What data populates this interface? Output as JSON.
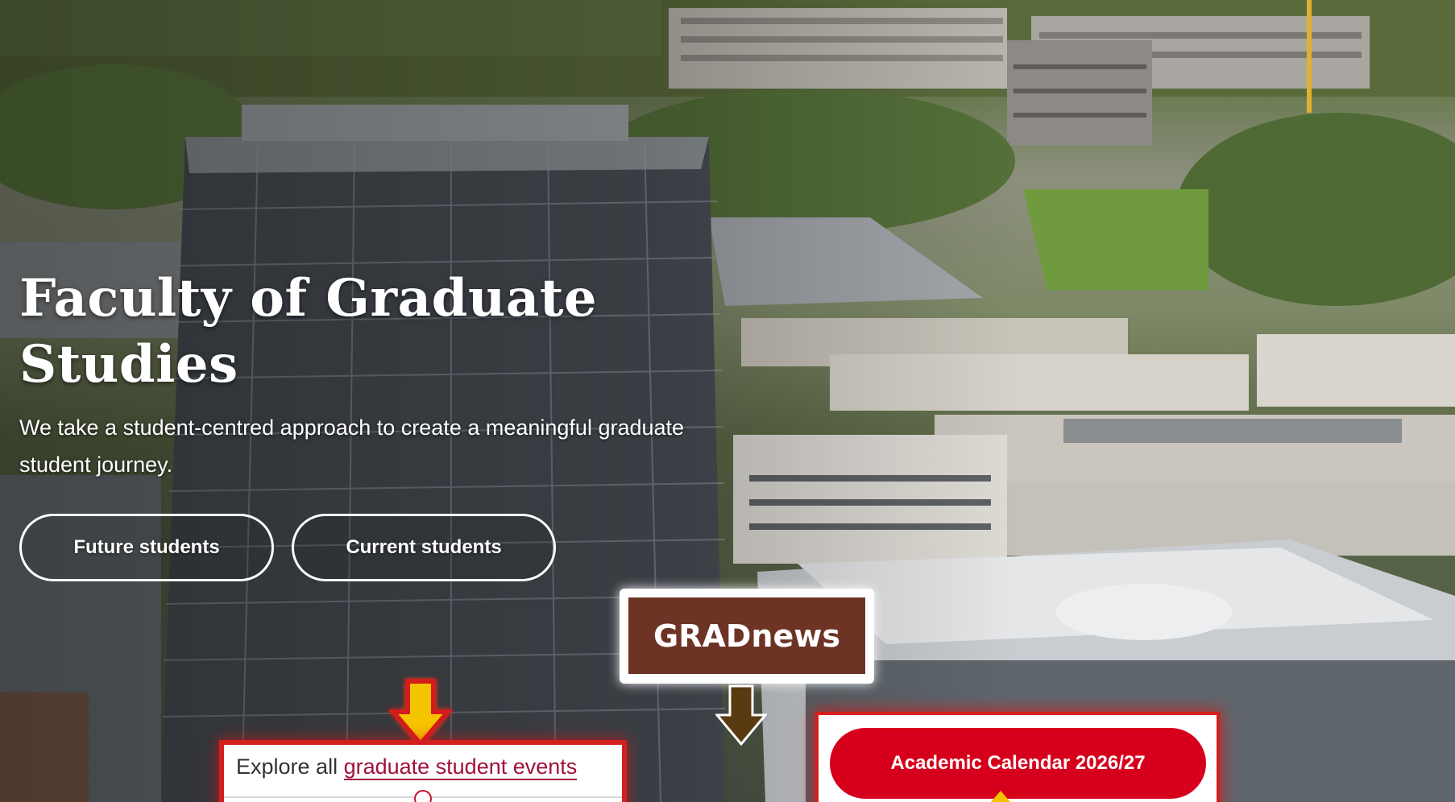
{
  "hero": {
    "title": "Faculty of Graduate Studies",
    "subtitle": "We take a student-centred approach to create a meaningful graduate student journey."
  },
  "buttons": {
    "future_students": "Future students",
    "current_students": "Current students",
    "academic_calendar": "Academic Calendar 2026/27"
  },
  "gradnews": {
    "label": "GRADnews"
  },
  "events": {
    "prefix": "Explore all ",
    "link_text": "graduate student events"
  },
  "icons": {
    "events_arrow": "arrow-down-icon",
    "gradnews_arrow": "arrow-down-icon",
    "calendar_caret": "caret-up-icon"
  },
  "colors": {
    "brand_red": "#d6001c",
    "gradnews_brown": "#6d3426",
    "link_crimson": "#a2103a",
    "arrow_yellow": "#f5c400",
    "arrow_brown": "#5a3a10",
    "highlight_red": "#d41f1f"
  }
}
